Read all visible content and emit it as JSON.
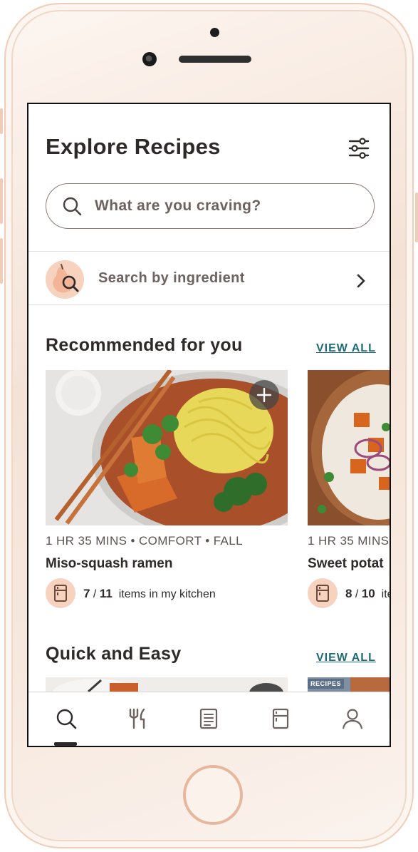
{
  "header": {
    "title": "Explore Recipes",
    "filter_icon": "sliders-icon"
  },
  "search": {
    "placeholder": "What are you craving?",
    "icon": "search-icon"
  },
  "ingredient_search": {
    "label": "Search by ingredient",
    "icon": "pear-search-icon",
    "chevron": "chevron-right-icon"
  },
  "recommended": {
    "title": "Recommended for you",
    "view_all": "VIEW ALL",
    "cards": [
      {
        "meta": "1 HR 35 MINS • COMFORT • FALL",
        "name": "Miso-squash ramen",
        "kitchen_have": "7",
        "kitchen_sep": "/",
        "kitchen_total": "11",
        "kitchen_suffix": "items in my kitchen"
      },
      {
        "meta": "1 HR 35 MINS",
        "name": "Sweet potat",
        "kitchen_have": "8",
        "kitchen_sep": "/",
        "kitchen_total": "10",
        "kitchen_suffix": "ite"
      }
    ]
  },
  "quick": {
    "title": "Quick and Easy",
    "view_all": "VIEW ALL",
    "badge": "RECIPES"
  },
  "nav": {
    "items": [
      "search-icon",
      "fork-knife-icon",
      "list-icon",
      "fridge-icon",
      "profile-icon"
    ],
    "active_index": 0
  },
  "colors": {
    "accent_link": "#1e6c78",
    "peach": "#f7d2bf",
    "text_dark": "#2d2a29",
    "text_muted": "#6e6260"
  }
}
